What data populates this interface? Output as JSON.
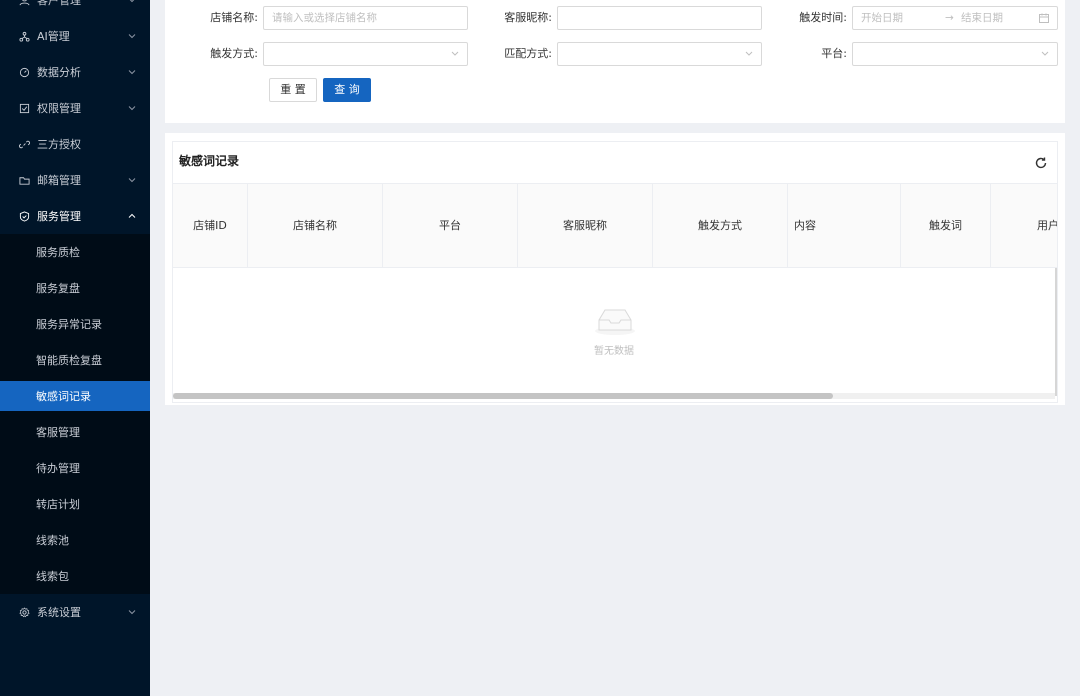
{
  "sidebar": {
    "top_cut_label": "客户管理",
    "items": [
      {
        "label": "AI管理",
        "icon": "network-icon"
      },
      {
        "label": "数据分析",
        "icon": "dashboard-icon"
      },
      {
        "label": "权限管理",
        "icon": "checkbox-icon"
      },
      {
        "label": "三方授权",
        "icon": "link-icon"
      },
      {
        "label": "邮箱管理",
        "icon": "folder-icon"
      },
      {
        "label": "服务管理",
        "icon": "shield-icon"
      }
    ],
    "submenu": [
      "服务质检",
      "服务复盘",
      "服务异常记录",
      "智能质检复盘",
      "敏感词记录",
      "客服管理",
      "待办管理",
      "转店计划",
      "线索池",
      "线索包"
    ],
    "active_submenu": "敏感词记录",
    "bottom_items": [
      {
        "label": "系统设置",
        "icon": "gear-icon"
      }
    ]
  },
  "search": {
    "shop_name_label": "店铺名称:",
    "shop_name_placeholder": "请输入或选择店铺名称",
    "agent_nick_label": "客服昵称:",
    "trigger_time_label": "触发时间:",
    "start_date_placeholder": "开始日期",
    "date_separator": "→",
    "end_date_placeholder": "结束日期",
    "trigger_method_label": "触发方式:",
    "match_method_label": "匹配方式:",
    "platform_label": "平台:",
    "reset_label": "重 置",
    "query_label": "查 询"
  },
  "table": {
    "title": "敏感词记录",
    "columns": [
      "店铺ID",
      "店铺名称",
      "平台",
      "客服昵称",
      "触发方式",
      "内容",
      "触发词",
      "用户:"
    ],
    "empty_text": "暂无数据"
  },
  "colors": {
    "sidebar_bg": "#001529",
    "accent": "#1565c0"
  }
}
